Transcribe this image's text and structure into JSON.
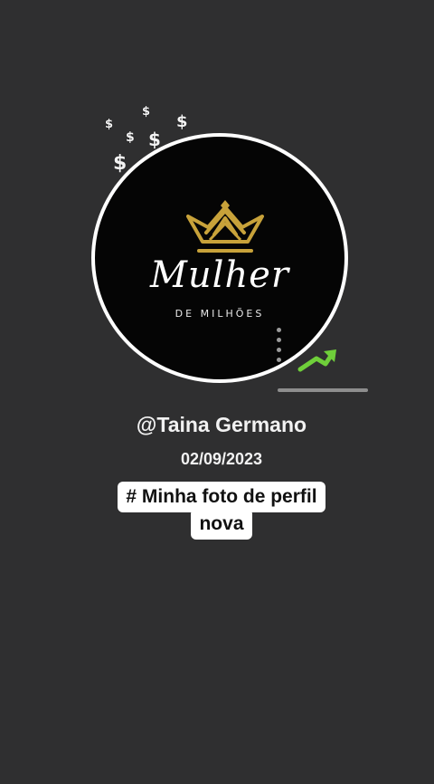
{
  "logo": {
    "script": "Mulher",
    "subtitle": "DE MILHÕES",
    "crown_color": "#c8a23a"
  },
  "decor": {
    "dollar_symbol": "$",
    "accent_color": "#6fcf3a"
  },
  "profile": {
    "username": "@Taina Germano",
    "date": "02/09/2023"
  },
  "caption": {
    "line1": "# Minha foto de perfil",
    "line2": "nova"
  }
}
